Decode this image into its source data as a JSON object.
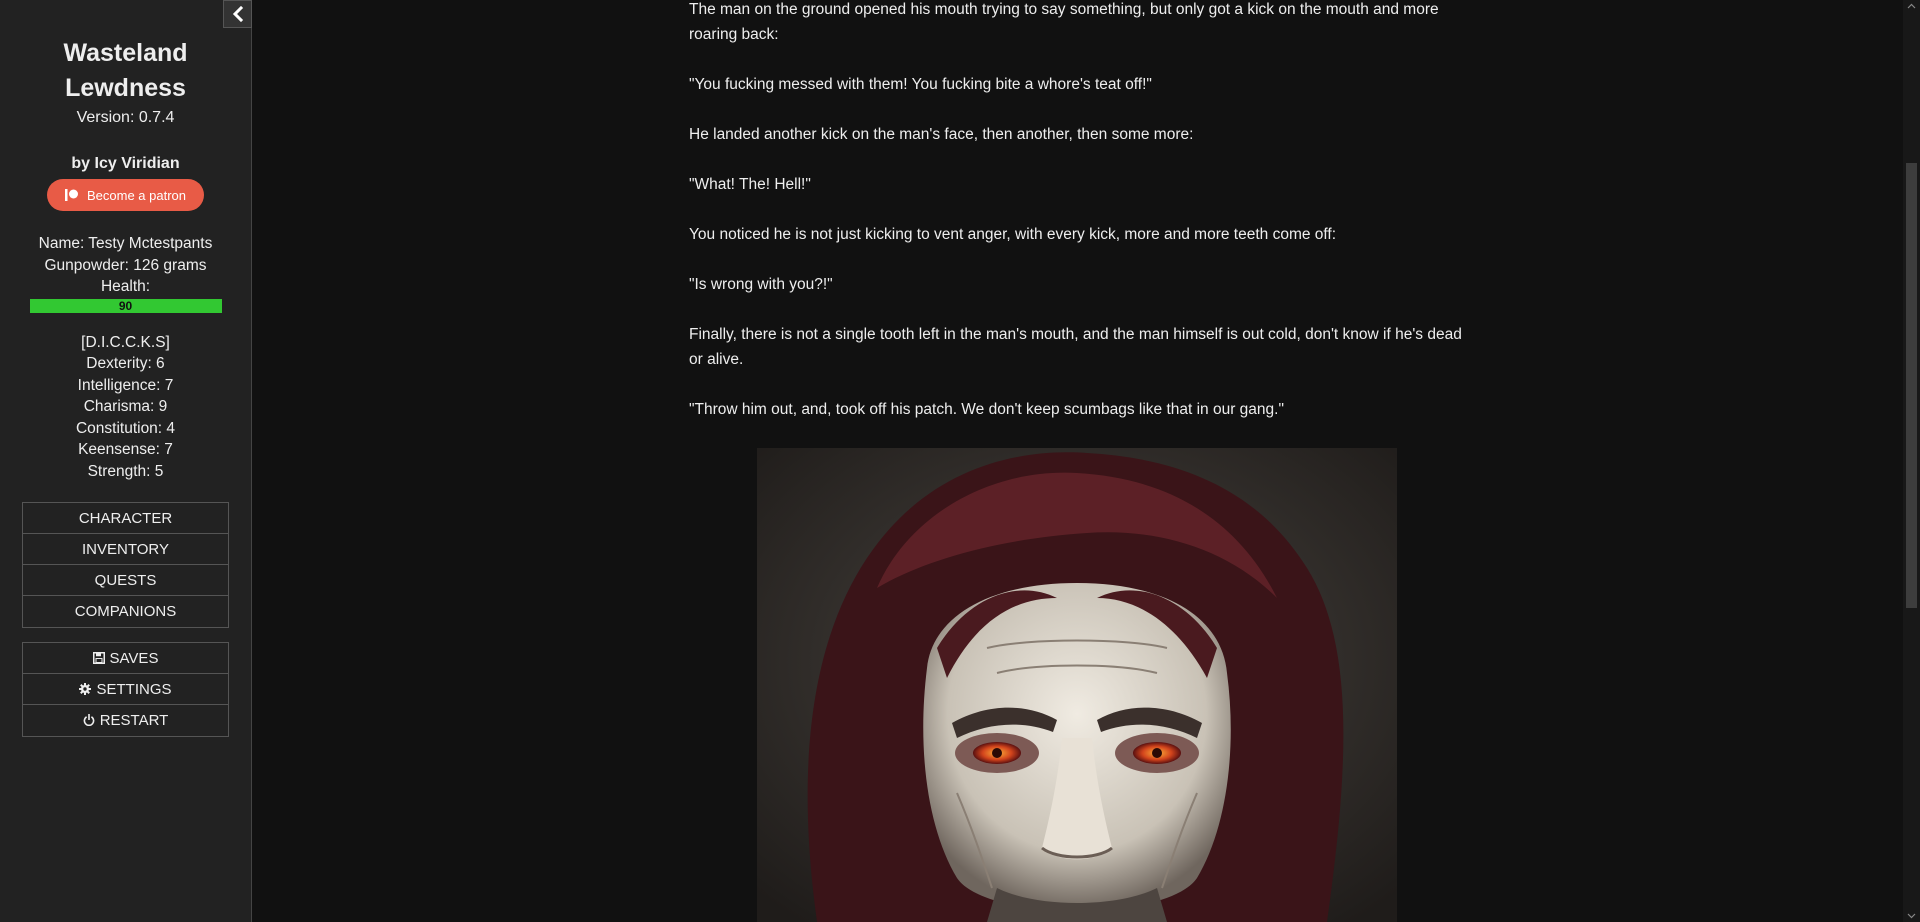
{
  "sidebar": {
    "title": "Wasteland Lewdness",
    "version": "Version: 0.7.4",
    "author": "by Icy Viridian",
    "patron_label": "Become a patron",
    "stats": {
      "name": "Name: Testy Mctestpants",
      "gunpowder": "Gunpowder: 126 grams",
      "health_label": "Health:",
      "health_value": "90",
      "health_fraction": 0.9
    },
    "attributes": {
      "header": "[D.I.C.C.K.S]",
      "dexterity": "Dexterity: 6",
      "intelligence": "Intelligence: 7",
      "charisma": "Charisma: 9",
      "constitution": "Constitution: 4",
      "keensense": "Keensense: 7",
      "strength": "Strength: 5"
    },
    "menu": {
      "character": "CHARACTER",
      "inventory": "INVENTORY",
      "quests": "QUESTS",
      "companions": "COMPANIONS"
    },
    "system_menu": {
      "saves": "SAVES",
      "settings": "SETTINGS",
      "restart": "RESTART"
    }
  },
  "passage": {
    "paragraphs": [
      "The man on the ground opened his mouth trying to say something, but only got a kick on the mouth and more roaring back:",
      "\"You fucking messed with them! You fucking bite a whore's teat off!\"",
      "He landed another kick on the man's face, then another, then some more:",
      "\"What! The! Hell!\"",
      "You noticed he is not just kicking to vent anger, with every kick, more and more teeth come off:",
      "\"Is wrong with you?!\"",
      "Finally, there is not a single tooth left in the man's mouth, and the man himself is out cold, don't know if he's dead or alive.",
      "\"Throw him out, and, took off his patch. We don't keep scumbags like that in our gang.\""
    ]
  },
  "colors": {
    "background": "#111111",
    "sidebar": "#222222",
    "patron_button": "#e85b46",
    "health_bar": "#32c832"
  },
  "icons": {
    "collapse": "chevron-left-icon",
    "patron": "patreon-icon",
    "saves": "floppy-disk-icon",
    "settings": "gear-icon",
    "restart": "power-icon"
  }
}
